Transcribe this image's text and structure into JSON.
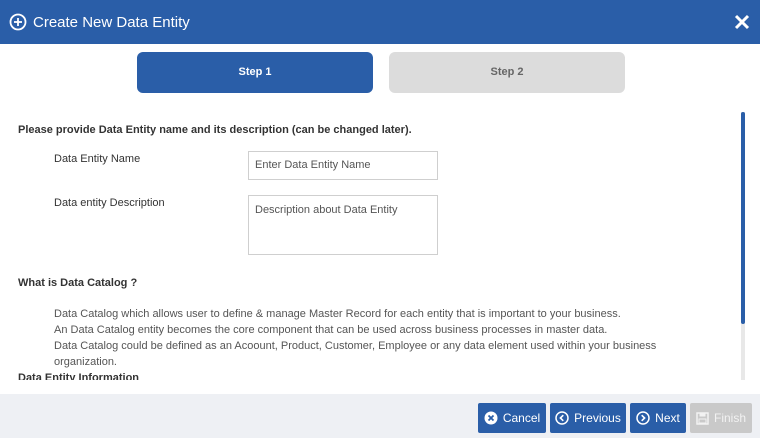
{
  "dialog": {
    "title": "Create New Data Entity",
    "icons": {
      "title": "add-circle-icon",
      "close": "close-icon"
    }
  },
  "steps": [
    {
      "label": "Step 1",
      "active": true
    },
    {
      "label": "Step 2",
      "active": false
    }
  ],
  "form": {
    "intro": "Please provide Data Entity name and its description (can be changed later).",
    "name_label": "Data Entity Name",
    "name_placeholder": "Enter Data Entity Name",
    "desc_label": "Data entity Description",
    "desc_placeholder": "Description about Data Entity"
  },
  "catalog": {
    "heading": "What is Data Catalog ?",
    "lines": [
      "Data Catalog which allows user to define & manage Master Record for each entity that is important to your business.",
      "An Data Catalog entity becomes the core component that can be used across business processes in master data.",
      "Data Catalog could be defined as an Acoount, Product, Customer, Employee or any data element used within your business organization."
    ],
    "next_heading": "Data Entity Information"
  },
  "footer": {
    "cancel": "Cancel",
    "previous": "Previous",
    "next": "Next",
    "finish": "Finish"
  },
  "colors": {
    "primary": "#2a5ea8",
    "disabled": "#c9c9c9",
    "inactive_step": "#dcdcdc"
  }
}
